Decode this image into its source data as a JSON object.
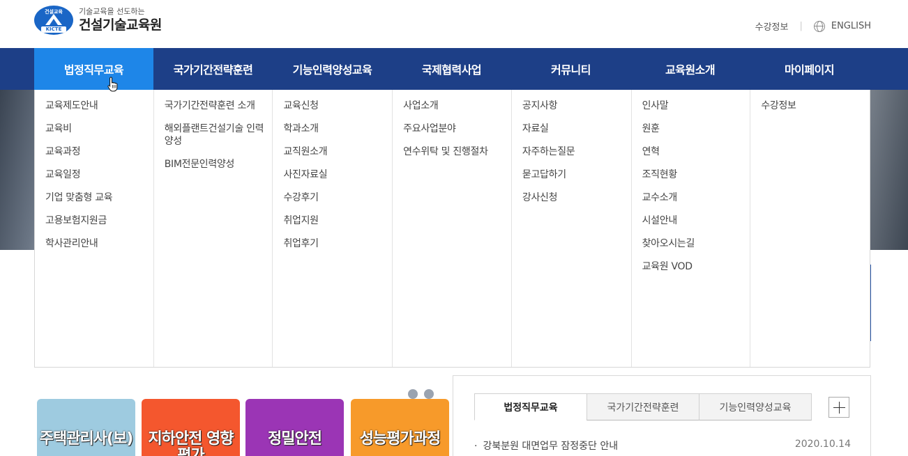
{
  "header": {
    "logo_emblem_top": "건설교육",
    "logo_emblem_bottom": "KICTE",
    "logo_sub": "기술교육을 선도하는",
    "logo_main": "건설기술교육원",
    "util_links": [
      "수강정보",
      "ENGLISH"
    ]
  },
  "nav": {
    "items": [
      "법정직무교육",
      "국가기간전략훈련",
      "기능인력양성교육",
      "국제협력사업",
      "커뮤니티",
      "교육원소개",
      "마이페이지"
    ],
    "active_index": 0
  },
  "dropdown": {
    "columns": [
      [
        "교육제도안내",
        "교육비",
        "교육과정",
        "교육일정",
        "기업 맞춤형 교육",
        "고용보험지원금",
        "학사관리안내"
      ],
      [
        "국가기간전략훈련 소개",
        "해외플랜트건설기술 인력양성",
        "BIM전문인력양성"
      ],
      [
        "교육신청",
        "학과소개",
        "교직원소개",
        "사진자료실",
        "수강후기",
        "취업지원",
        "취업후기"
      ],
      [
        "사업소개",
        "주요사업분야",
        "연수위탁 및 진행절차"
      ],
      [
        "공지사항",
        "자료실",
        "자주하는질문",
        "묻고답하기",
        "강사신청"
      ],
      [
        "인사말",
        "원훈",
        "연혁",
        "조직현황",
        "교수소개",
        "시설안내",
        "찾아오시는길",
        "교육원 VOD"
      ],
      [
        "수강정보"
      ]
    ]
  },
  "cards": [
    {
      "label": "주택관리사(보)",
      "color": "#9ecbe0"
    },
    {
      "label": "지하안전 영향평가",
      "color": "#f4572e"
    },
    {
      "label": "정밀안전",
      "color": "#9b35b5"
    },
    {
      "label": "성능평가과정",
      "color": "#f79a2a"
    }
  ],
  "notice": {
    "tabs": [
      "법정직무교육",
      "국가기간전략훈련",
      "기능인력양성교육"
    ],
    "active_tab": 0,
    "items": [
      {
        "title": "강북분원 대면업무 잠정중단 안내",
        "date": "2020.10.14"
      }
    ]
  },
  "colors": {
    "nav_bg": "#1d3f87",
    "nav_active": "#1e86e8"
  }
}
